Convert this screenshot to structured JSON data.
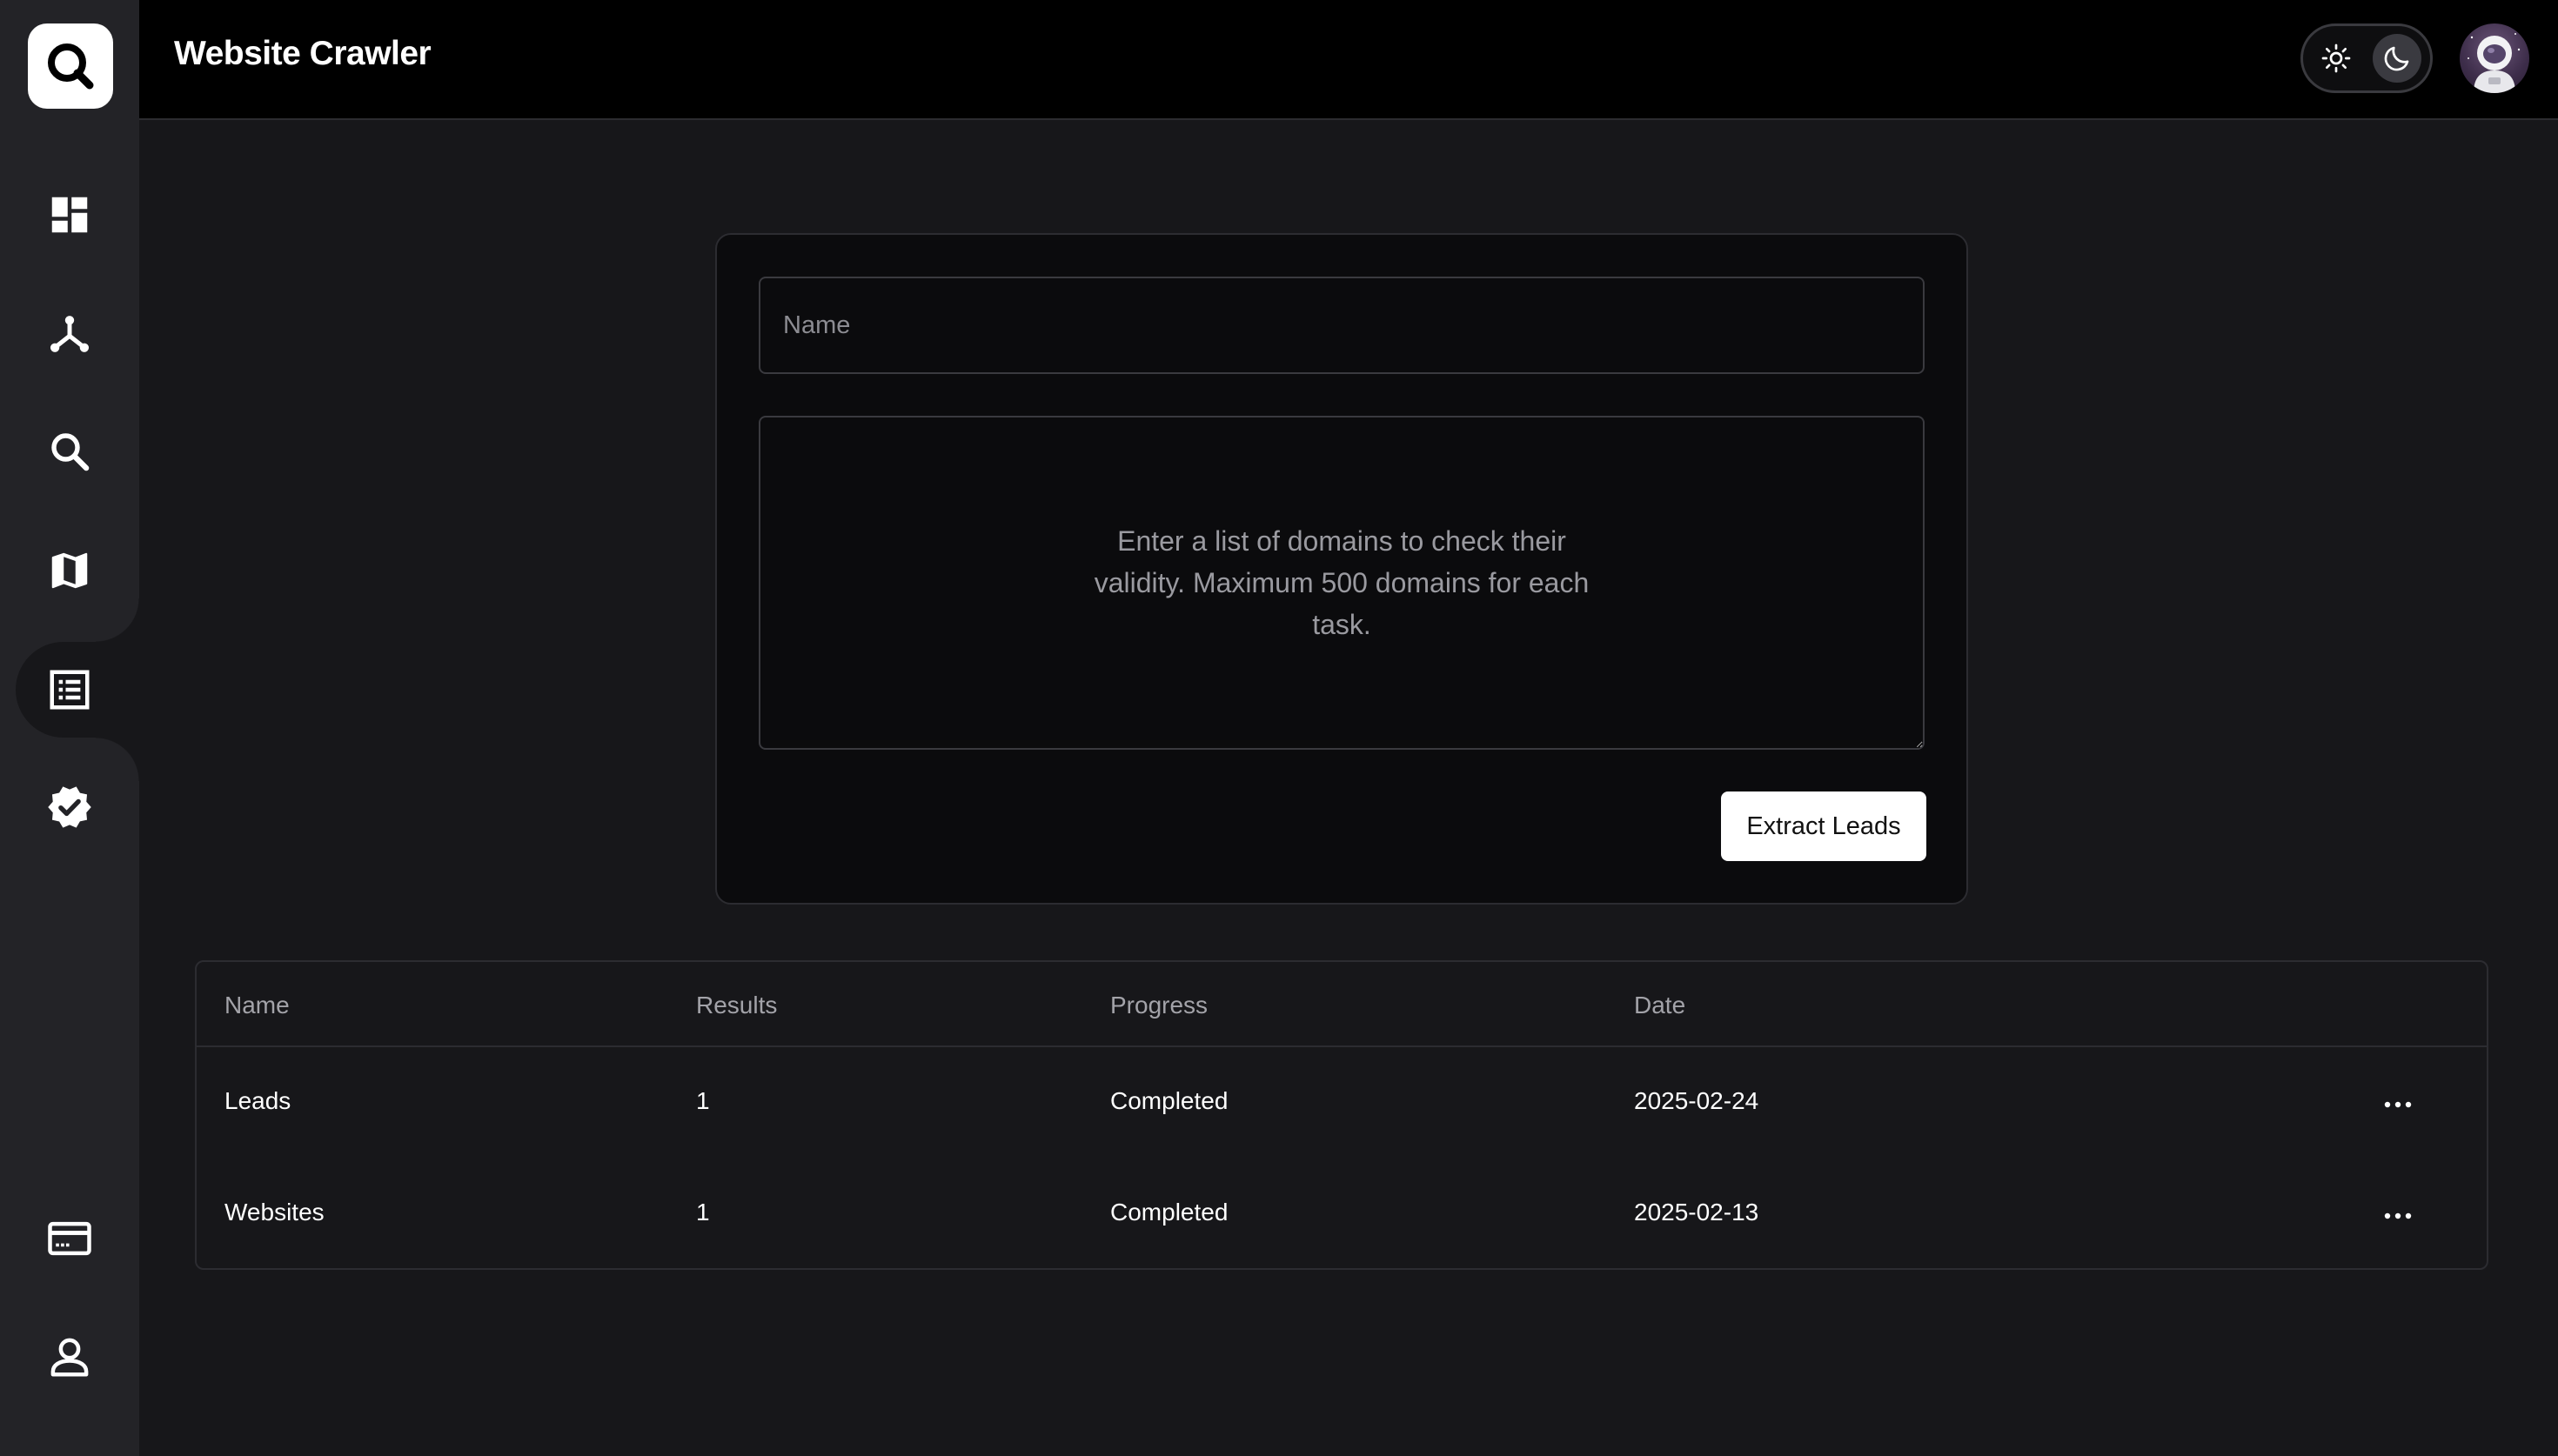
{
  "app": {
    "title": "Website Crawler",
    "logo_icon": "search-logo-icon"
  },
  "sidebar": {
    "items": [
      {
        "name": "dashboard",
        "icon": "dashboard-icon"
      },
      {
        "name": "workflows",
        "icon": "share-hub-icon"
      },
      {
        "name": "search",
        "icon": "search-icon"
      },
      {
        "name": "maps",
        "icon": "map-icon"
      },
      {
        "name": "website-crawler",
        "icon": "list-icon",
        "active": true
      },
      {
        "name": "verify",
        "icon": "verified-badge-icon"
      }
    ],
    "bottom_items": [
      {
        "name": "billing",
        "icon": "credit-card-icon"
      },
      {
        "name": "profile",
        "icon": "user-icon"
      }
    ]
  },
  "header": {
    "theme": {
      "light_icon": "sun-icon",
      "dark_icon": "moon-icon",
      "selected": "dark"
    },
    "avatar_icon": "astronaut-avatar"
  },
  "form": {
    "name_placeholder": "Name",
    "name_value": "",
    "domains_placeholder": "Enter a list of domains to check their validity. Maximum 500 domains for each task.",
    "domains_value": "",
    "submit_label": "Extract Leads"
  },
  "table": {
    "columns": [
      "Name",
      "Results",
      "Progress",
      "Date"
    ],
    "rows": [
      {
        "name": "Leads",
        "results": "1",
        "progress": "Completed",
        "date": "2025-02-24"
      },
      {
        "name": "Websites",
        "results": "1",
        "progress": "Completed",
        "date": "2025-02-13"
      }
    ]
  },
  "colors": {
    "background": "#17171a",
    "sidebar": "#232327",
    "header": "#000000",
    "card": "#0b0b0d",
    "border": "#2c2c31",
    "button_bg": "#ffffff",
    "muted_text": "#a3a3a9"
  }
}
